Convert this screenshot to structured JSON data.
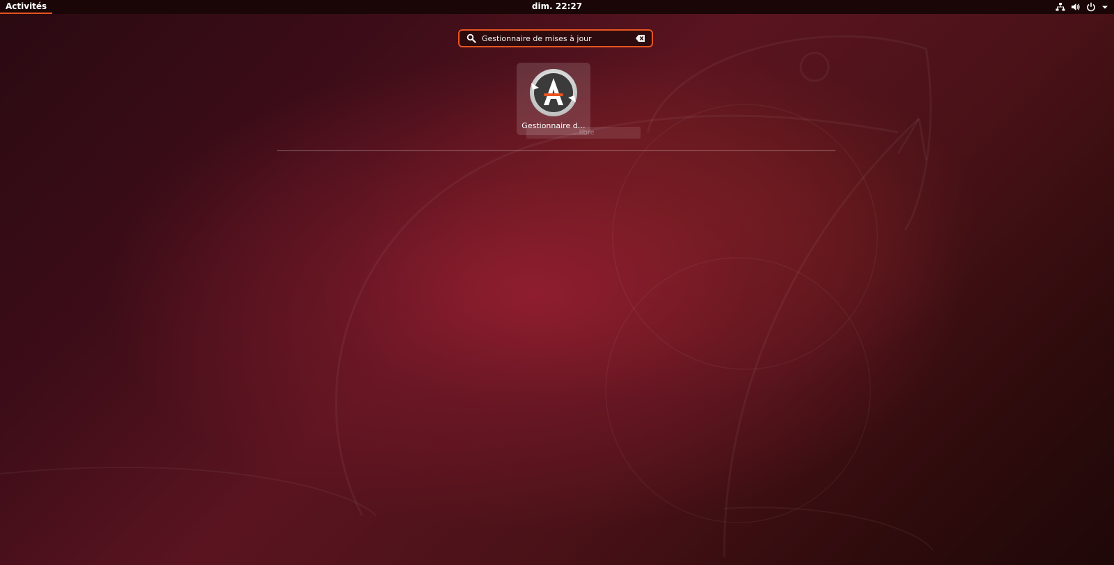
{
  "topbar": {
    "activities_label": "Activités",
    "clock": "dim. 22:27",
    "tray_icons": [
      "network-icon",
      "volume-icon",
      "power-icon",
      "menu-arrow-icon"
    ]
  },
  "search": {
    "value": "Gestionnaire de mises à jour",
    "icon": "search-icon",
    "clear_icon": "clear-icon"
  },
  "results": [
    {
      "label": "Gestionnaire d…",
      "icon": "software-updater-icon"
    }
  ],
  "tooltip_ghost": "...libre",
  "colors": {
    "accent": "#e95420",
    "topbar": "#1a0606"
  }
}
